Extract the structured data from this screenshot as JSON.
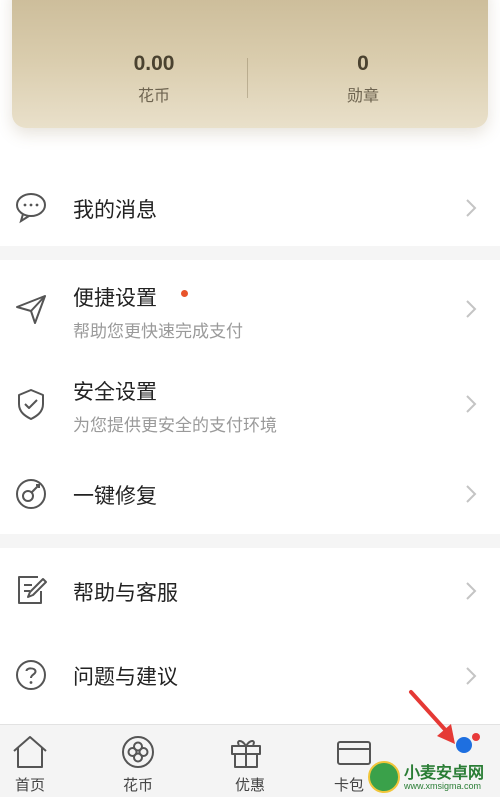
{
  "account": {
    "coins_value": "0.00",
    "coins_label": "花币",
    "medals_value": "0",
    "medals_label": "勋章"
  },
  "menu": {
    "messages": {
      "title": "我的消息",
      "icon": "chat-bubble-icon"
    },
    "quick_settings": {
      "title": "便捷设置",
      "subtitle": "帮助您更快速完成支付",
      "icon": "send-arrow-icon",
      "has_badge": true
    },
    "security_settings": {
      "title": "安全设置",
      "subtitle": "为您提供更安全的支付环境",
      "icon": "shield-check-icon"
    },
    "one_click_repair": {
      "title": "一键修复",
      "icon": "repair-icon"
    },
    "help_service": {
      "title": "帮助与客服",
      "icon": "edit-document-icon"
    },
    "feedback": {
      "title": "问题与建议",
      "icon": "question-circle-icon"
    }
  },
  "tabbar": {
    "tabs": [
      {
        "label": "首页",
        "icon": "home-icon"
      },
      {
        "label": "花币",
        "icon": "flower-coin-icon"
      },
      {
        "label": "优惠",
        "icon": "gift-icon"
      },
      {
        "label": "卡包",
        "icon": "card-icon"
      },
      {
        "label": "",
        "icon": "me-icon"
      }
    ]
  },
  "watermark": {
    "text": "小麦安卓网",
    "url": "www.xmsigma.com"
  },
  "colors": {
    "badge": "#e8542b",
    "card_gold": "#d9ccad",
    "accent_blue": "#1e6fe0",
    "arrow": "#e53935"
  }
}
